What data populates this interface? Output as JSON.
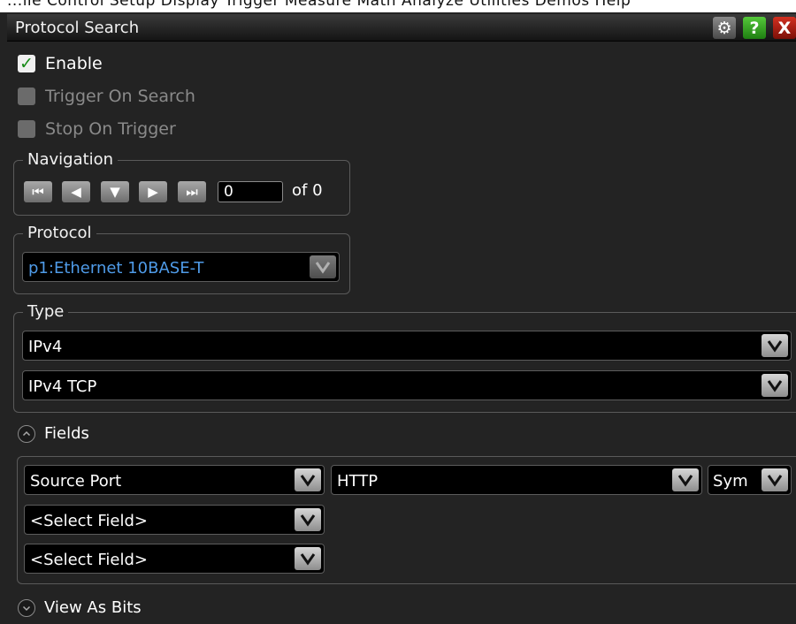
{
  "menu_strip_text": "...ile Control Setup Display Trigger Measure Math Analyze Utilities Demos Help",
  "window": {
    "title": "Protocol Search",
    "gear_glyph": "⚙",
    "help_glyph": "?",
    "close_glyph": "X"
  },
  "checkboxes": {
    "enable": {
      "label": "Enable",
      "checked": true,
      "check_glyph": "✓"
    },
    "trigger_on_search": {
      "label": "Trigger On Search",
      "checked": false
    },
    "stop_on_trigger": {
      "label": "Stop On Trigger",
      "checked": false
    }
  },
  "navigation": {
    "label": "Navigation",
    "first_glyph": "⏮",
    "prev_glyph": "◀",
    "down_glyph": "▼",
    "next_glyph": "▶",
    "last_glyph": "⏭",
    "current_value": "0",
    "of_text": "of 0"
  },
  "protocol": {
    "label": "Protocol",
    "selected": "p1:Ethernet 10BASE-T"
  },
  "type": {
    "label": "Type",
    "primary": "IPv4",
    "secondary": "IPv4 TCP"
  },
  "fields": {
    "label": "Fields",
    "field1": "Source Port",
    "field1_value": "HTTP",
    "field1_format": "Sym",
    "field2": "<Select Field>",
    "field3": "<Select Field>"
  },
  "view_as_bits": {
    "label": "View As Bits"
  },
  "colors": {
    "background": "#232323",
    "protocol_text": "#4f9be8",
    "enable_check": "#178a17",
    "help_button": "#2fa81f",
    "close_button": "#b02010"
  }
}
